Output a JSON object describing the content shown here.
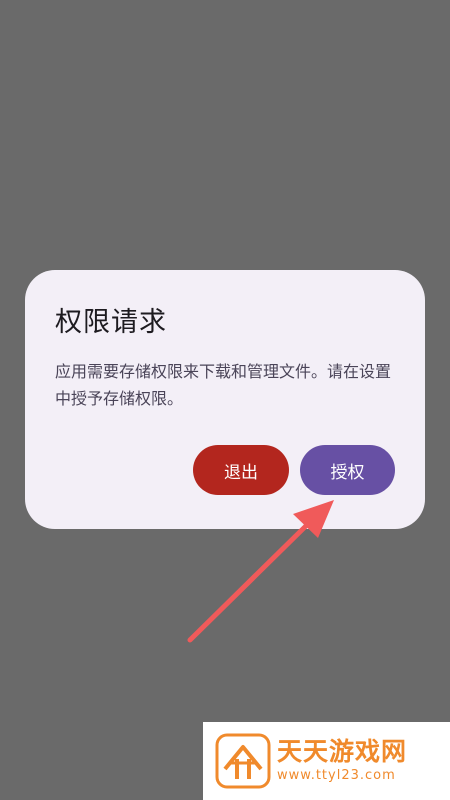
{
  "dialog": {
    "title": "权限请求",
    "message": "应用需要存储权限来下载和管理文件。请在设置中授予存储权限。",
    "exit_label": "退出",
    "grant_label": "授权"
  },
  "watermark": {
    "name": "天天游戏网",
    "url": "www.ttyl23.com"
  },
  "colors": {
    "overlay": "#6a6a6a",
    "dialog_bg": "#f3eff7",
    "exit_button": "#b3261e",
    "grant_button": "#6750a4",
    "arrow": "#f05a5a",
    "watermark": "#f08a2c"
  }
}
